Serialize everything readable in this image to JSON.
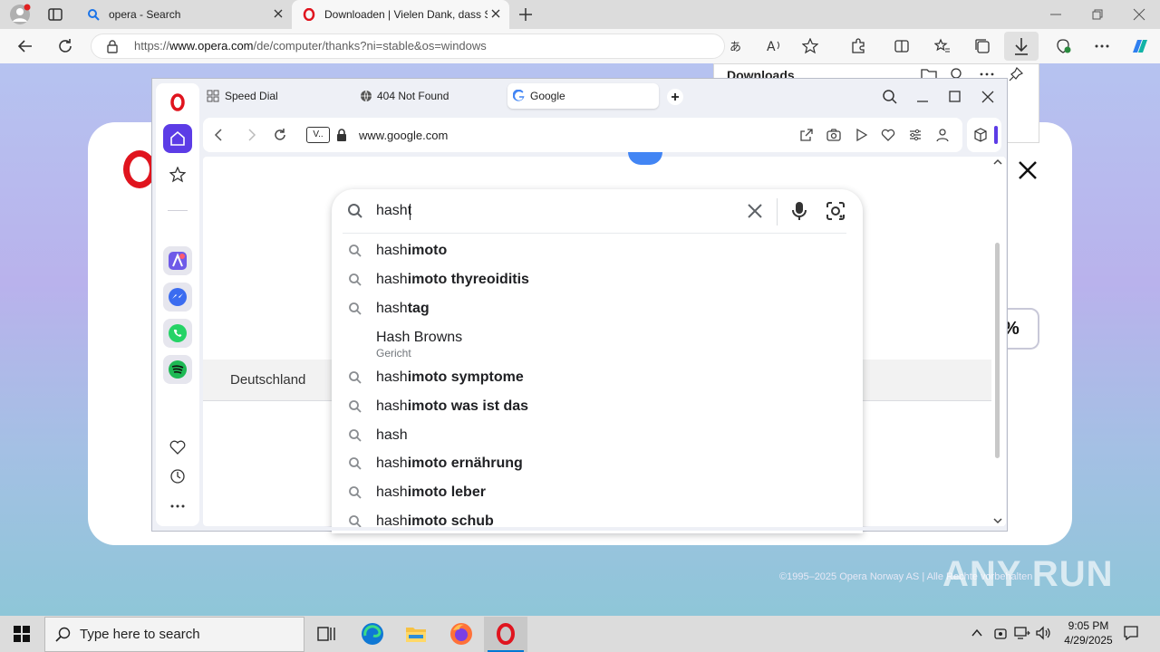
{
  "edge": {
    "tabs": [
      {
        "title": "opera - Search"
      },
      {
        "title": "Downloaden | Vielen Dank, dass Sie"
      }
    ],
    "url_prefix": "https://",
    "url_domain": "www.opera.com",
    "url_path": "/de/computer/thanks?ni=stable&os=windows"
  },
  "downloads": {
    "title": "Downloads"
  },
  "page": {
    "percent_suffix": "%",
    "copyright": "©1995–2025 Opera Norway AS | Alle Rechte vorbehalten",
    "watermark": "ANY RUN"
  },
  "opera": {
    "tabs": [
      {
        "title": "Speed Dial"
      },
      {
        "title": "404 Not Found"
      },
      {
        "title": "Google"
      }
    ],
    "address": "www.google.com",
    "vpn_badge": "V..",
    "colors": {
      "accent": "#5c3ce6",
      "logo": "#e0141e"
    }
  },
  "google": {
    "query": "hasht",
    "country": "Deutschland",
    "suggestions": [
      {
        "prefix": "hash",
        "completion": "imoto"
      },
      {
        "prefix": "hash",
        "completion": "imoto thyreoiditis"
      },
      {
        "prefix": "hash",
        "completion": "tag"
      },
      {
        "title": "Hash Browns",
        "subtitle": "Gericht"
      },
      {
        "prefix": "hash",
        "completion": "imoto symptome"
      },
      {
        "prefix": "hash",
        "completion": "imoto was ist das"
      },
      {
        "prefix": "hash",
        "completion": ""
      },
      {
        "prefix": "hash",
        "completion": "imoto ernährung"
      },
      {
        "prefix": "hash",
        "completion": "imoto leber"
      },
      {
        "prefix": "hash",
        "completion": "imoto schub"
      }
    ]
  },
  "taskbar": {
    "search_placeholder": "Type here to search",
    "time": "9:05 PM",
    "date": "4/29/2025"
  }
}
